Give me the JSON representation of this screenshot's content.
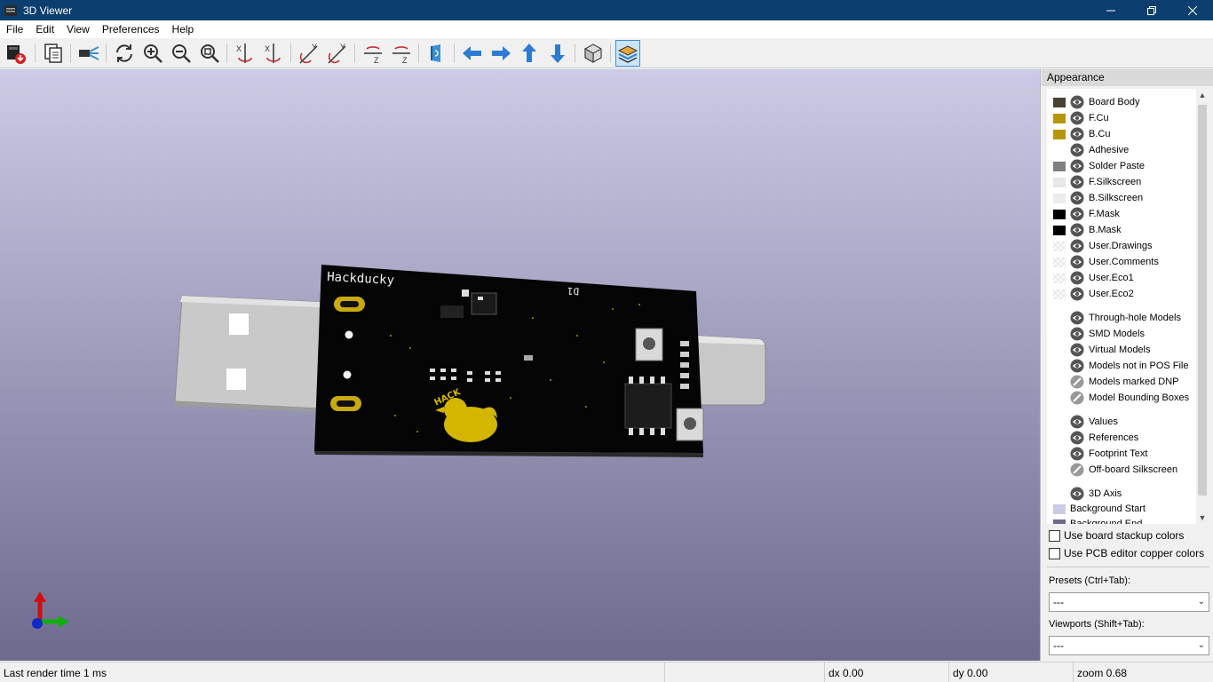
{
  "window": {
    "title": "3D Viewer"
  },
  "menu": [
    "File",
    "Edit",
    "View",
    "Preferences",
    "Help"
  ],
  "toolbar": {
    "buttons": [
      {
        "icon": "export-image-icon"
      },
      {
        "icon": "copy-to-clipboard-icon"
      },
      {
        "icon": "raytracing-icon"
      },
      {
        "icon": "reload-icon"
      },
      {
        "icon": "zoom-in-icon"
      },
      {
        "icon": "zoom-out-icon"
      },
      {
        "icon": "zoom-fit-icon"
      },
      {
        "icon": "rotate-x-cw-icon"
      },
      {
        "icon": "rotate-x-ccw-icon"
      },
      {
        "icon": "rotate-y-cw-icon"
      },
      {
        "icon": "rotate-y-ccw-icon"
      },
      {
        "icon": "rotate-z-cw-icon"
      },
      {
        "icon": "rotate-z-ccw-icon"
      },
      {
        "icon": "flip-board-icon"
      },
      {
        "icon": "arrow-left-icon"
      },
      {
        "icon": "arrow-right-icon"
      },
      {
        "icon": "arrow-up-icon"
      },
      {
        "icon": "arrow-down-icon"
      },
      {
        "icon": "ortho-view-icon"
      },
      {
        "icon": "layers-panel-icon",
        "active": true
      }
    ]
  },
  "viewport": {
    "board_silkscreen": "Hackducky",
    "board_refdes": "D1",
    "duck_label": "HACK",
    "colors": {
      "background_top": "#cccbe6",
      "background_bottom": "#6d6a8e",
      "board": "#050505",
      "copper": "#c8a910",
      "duck": "#d4b600"
    }
  },
  "appearance": {
    "header": "Appearance",
    "layers": [
      {
        "label": "Board Body",
        "color": "#4a4033",
        "visible": true
      },
      {
        "label": "F.Cu",
        "color": "#b8960c",
        "visible": true
      },
      {
        "label": "B.Cu",
        "color": "#b8960c",
        "visible": true
      },
      {
        "label": "Adhesive",
        "color": "",
        "visible": true
      },
      {
        "label": "Solder Paste",
        "color": "#808080",
        "visible": true
      },
      {
        "label": "F.Silkscreen",
        "color": "#e6e6e6",
        "visible": true
      },
      {
        "label": "B.Silkscreen",
        "color": "#ececec",
        "visible": true
      },
      {
        "label": "F.Mask",
        "color": "#000000",
        "visible": true
      },
      {
        "label": "B.Mask",
        "color": "#000000",
        "visible": true
      },
      {
        "label": "User.Drawings",
        "color": "checker",
        "visible": true
      },
      {
        "label": "User.Comments",
        "color": "checker",
        "visible": true
      },
      {
        "label": "User.Eco1",
        "color": "checker",
        "visible": true
      },
      {
        "label": "User.Eco2",
        "color": "checker",
        "visible": true
      }
    ],
    "models": [
      {
        "label": "Through-hole Models",
        "visible": true
      },
      {
        "label": "SMD Models",
        "visible": true
      },
      {
        "label": "Virtual Models",
        "visible": true
      },
      {
        "label": "Models not in POS File",
        "visible": true
      },
      {
        "label": "Models marked DNP",
        "visible": false
      },
      {
        "label": "Model Bounding Boxes",
        "visible": false
      }
    ],
    "texts": [
      {
        "label": "Values",
        "visible": true
      },
      {
        "label": "References",
        "visible": true
      },
      {
        "label": "Footprint Text",
        "visible": true
      },
      {
        "label": "Off-board Silkscreen",
        "visible": false
      }
    ],
    "misc": [
      {
        "label": "3D Axis",
        "visible": true
      },
      {
        "label": "Background Start",
        "color": "#cccbe6"
      },
      {
        "label": "Background End",
        "color": "#6d6a8e"
      }
    ],
    "use_stackup_colors": "Use board stackup colors",
    "use_copper_colors": "Use PCB editor copper colors",
    "presets_label": "Presets (Ctrl+Tab):",
    "presets_value": "---",
    "viewports_label": "Viewports (Shift+Tab):",
    "viewports_value": "---"
  },
  "status": {
    "render_time": "Last render time 1 ms",
    "dx": "dx 0.00",
    "dy": "dy 0.00",
    "zoom": "zoom 0.68"
  }
}
